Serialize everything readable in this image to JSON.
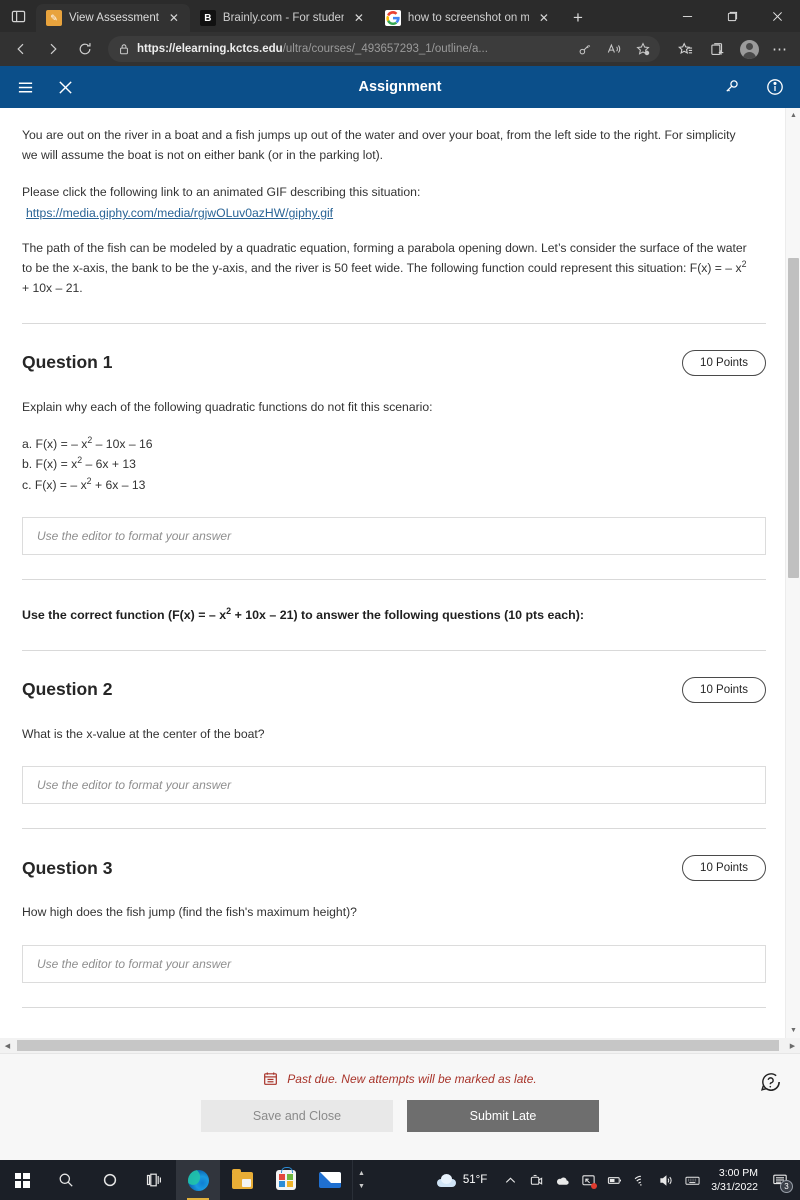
{
  "browser": {
    "tabs": [
      {
        "title": "View Assessment",
        "favicon": "pencil-icon",
        "active": true
      },
      {
        "title": "Brainly.com - For students. B",
        "favicon": "brainly-icon",
        "active": false
      },
      {
        "title": "how to screenshot on micros",
        "favicon": "google-icon",
        "active": false
      }
    ],
    "new_tab_label": "+",
    "window_controls": {
      "minimize": "─",
      "restore": "❐",
      "close": "✕"
    },
    "url_bold": "https://elearning.kctcs.edu",
    "url_rest": "/ultra/courses/_493657293_1/outline/a...",
    "nav": {
      "back": "back-arrow",
      "forward": "forward-arrow",
      "refresh": "refresh-icon"
    }
  },
  "app_header": {
    "title": "Assignment",
    "menu_icon": "hamburger-menu-icon",
    "close_icon": "close-icon",
    "right_icons": [
      "key-icon",
      "info-icon"
    ]
  },
  "content": {
    "intro_paragraph": "You are out on the river in a boat and a fish jumps up out of the water and over your boat, from the left side to the right. For simplicity we will assume the boat is not on either bank (or in the parking lot).",
    "gif_prompt": "Please click the following link to an animated GIF describing this situation:",
    "gif_link": "https://media.giphy.com/media/rgjwOLuv0azHW/giphy.gif",
    "model_paragraph_pre": "The path of the fish can be modeled by a quadratic equation, forming a parabola opening down. Let’s consider the surface of the water to be the x-axis, the bank to be the y-axis, and the river is 50 feet wide. The following function could represent this situation: F(x) = – x",
    "model_paragraph_sup": "2",
    "model_paragraph_post": " + 10x – 21.",
    "questions": [
      {
        "title": "Question 1",
        "points": "10 Points",
        "prompt": "Explain why each of the following quadratic functions do not fit this scenario:",
        "equations": [
          {
            "pre": "a. F(x) = – x",
            "sup": "2",
            "post": " – 10x – 16"
          },
          {
            "pre": "b. F(x) = x",
            "sup": "2",
            "post": " – 6x + 13"
          },
          {
            "pre": "c. F(x) = – x",
            "sup": "2",
            "post": " + 6x – 13"
          }
        ],
        "answer_placeholder": "Use the editor to format your answer"
      },
      {
        "title": "Question 2",
        "points": "10 Points",
        "prompt": "What is the x-value at the center of the boat?",
        "answer_placeholder": "Use the editor to format your answer"
      },
      {
        "title": "Question 3",
        "points": "10 Points",
        "prompt": "How high does the fish jump (find the fish's maximum height)?",
        "answer_placeholder": "Use the editor to format your answer"
      }
    ],
    "instruction_pre": "Use the correct function (F(x) = – x",
    "instruction_sup": "2",
    "instruction_post": " + 10x – 21) to answer the following questions (10 pts each):"
  },
  "bottom_bar": {
    "past_due_text": "Past due. New attempts will be marked as late.",
    "calendar_icon": "calendar-icon",
    "save_label": "Save and Close",
    "submit_label": "Submit Late",
    "help_icon": "help-question-icon"
  },
  "taskbar": {
    "start_icon": "windows-start-icon",
    "search_icon": "search-icon",
    "cortana_icon": "cortana-circle-icon",
    "taskview_icon": "task-view-icon",
    "apps": [
      "edge-icon",
      "file-explorer-icon",
      "microsoft-store-icon",
      "mail-icon"
    ],
    "weather_temp": "51°F",
    "weather_icon": "cloud-icon",
    "tray_expand": "chevron-up-icon",
    "tray_icons": [
      "camera-icon",
      "onedrive-icon",
      "screen-share-icon",
      "battery-icon",
      "wifi-icon",
      "volume-icon",
      "keyboard-icon"
    ],
    "time": "3:00 PM",
    "date": "3/31/2022",
    "notification_count": "3"
  },
  "colors": {
    "header_blue": "#0b4f8a",
    "link_blue": "#2a6496",
    "past_due_red": "#a8342a",
    "submit_gray": "#6e6e6e"
  }
}
